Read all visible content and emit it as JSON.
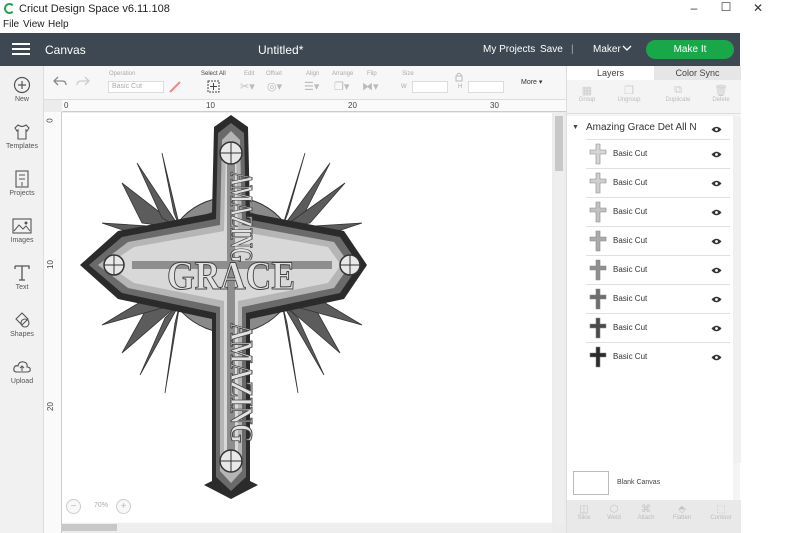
{
  "window": {
    "title": "Cricut Design Space  v6.11.108",
    "minimize_glyph": "–",
    "maximize_glyph": "☐",
    "close_glyph": "✕"
  },
  "menubar": {
    "items": [
      "File",
      "View",
      "Help"
    ]
  },
  "header": {
    "section": "Canvas",
    "doc_title": "Untitled*",
    "my_projects": "My Projects",
    "save": "Save",
    "separator": "|",
    "machine": "Maker",
    "make_it": "Make It"
  },
  "sidebar": {
    "items": [
      {
        "label": "New",
        "icon": "plus-circle-icon"
      },
      {
        "label": "Templates",
        "icon": "shirt-icon"
      },
      {
        "label": "Projects",
        "icon": "projects-icon"
      },
      {
        "label": "Images",
        "icon": "image-icon"
      },
      {
        "label": "Text",
        "icon": "text-icon"
      },
      {
        "label": "Shapes",
        "icon": "shapes-icon"
      },
      {
        "label": "Upload",
        "icon": "cloud-upload-icon"
      }
    ]
  },
  "toolbar": {
    "operation_label": "Operation",
    "operation_value": "Basic Cut",
    "select_all": "Select All",
    "edit": "Edit",
    "offset": "Offset",
    "align": "Align",
    "arrange": "Arrange",
    "flip": "Flip",
    "size": "Size",
    "w": "W",
    "h": "H",
    "more": "More ▾"
  },
  "rulers": {
    "top": [
      "0",
      "10",
      "20",
      "30"
    ],
    "left": [
      "0",
      "10",
      "20"
    ]
  },
  "canvas": {
    "design_text_vertical": "AMAZING",
    "design_text_horizontal": "GRACE",
    "zoom": "70%",
    "colors": {
      "dark": "#2b2b2b",
      "mid": "#6a6a6a",
      "light": "#b5b5b5",
      "pale": "#d8d8d8"
    }
  },
  "panel": {
    "tab_layers": "Layers",
    "tab_color_sync": "Color Sync",
    "actions": [
      "Group",
      "Ungroup",
      "Duplicate",
      "Delete"
    ],
    "group_name": "Amazing Grace Det All N",
    "layers": [
      {
        "name": "Basic Cut",
        "color": "#d6d6d6"
      },
      {
        "name": "Basic Cut",
        "color": "#cfcfcf"
      },
      {
        "name": "Basic Cut",
        "color": "#c2c2c2"
      },
      {
        "name": "Basic Cut",
        "color": "#ababab"
      },
      {
        "name": "Basic Cut",
        "color": "#8f8f8f"
      },
      {
        "name": "Basic Cut",
        "color": "#6e6e6e"
      },
      {
        "name": "Basic Cut",
        "color": "#4a4a4a"
      },
      {
        "name": "Basic Cut",
        "color": "#2a2a2a"
      }
    ],
    "blank_canvas": "Blank Canvas",
    "bottom_actions": [
      "Slice",
      "Weld",
      "Attach",
      "Flatten",
      "Contour"
    ]
  }
}
